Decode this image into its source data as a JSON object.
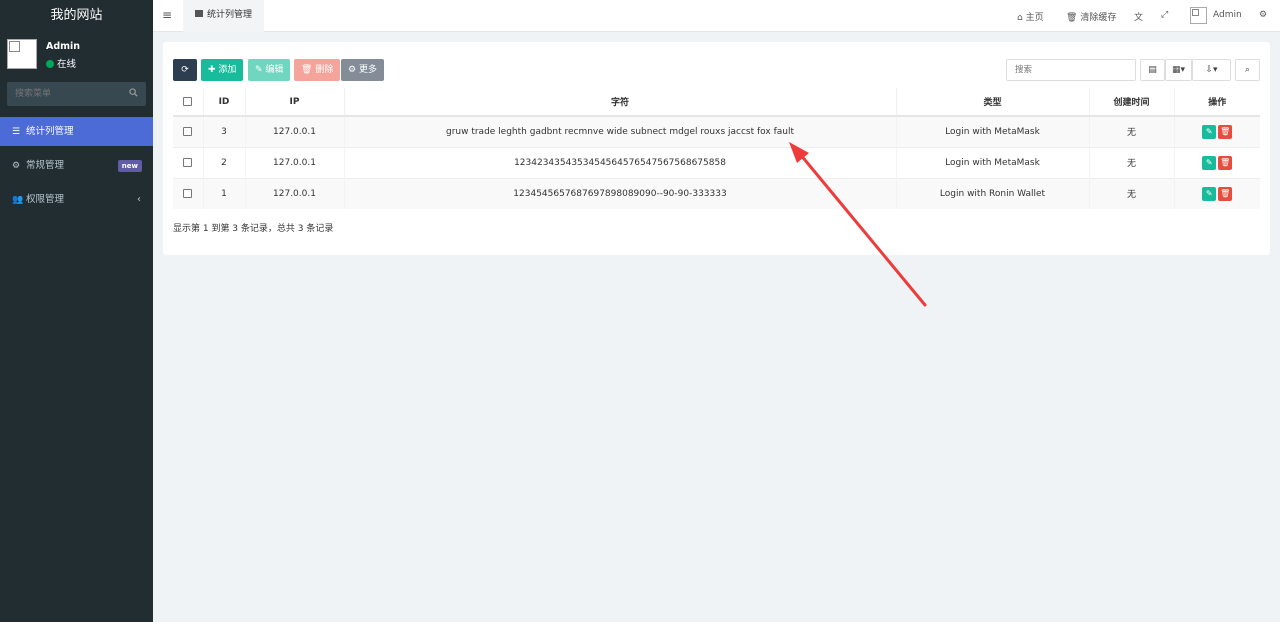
{
  "sidebar": {
    "logo": "我的网站",
    "user_name": "Admin",
    "user_status": "在线",
    "search_placeholder": "搜索菜单",
    "items": [
      {
        "label": "统计列管理",
        "icon": "list-icon",
        "active": true
      },
      {
        "label": "常规管理",
        "icon": "gears-icon",
        "badge": "new"
      },
      {
        "label": "权限管理",
        "icon": "users-icon"
      }
    ]
  },
  "topbar": {
    "tab_label": "统计列管理",
    "home": "主页",
    "clear_cache": "清除缓存",
    "user": "Admin"
  },
  "toolbar": {
    "add": "添加",
    "edit": "编辑",
    "delete": "删除",
    "more": "更多",
    "search_placeholder": "搜索"
  },
  "table": {
    "headers": [
      "ID",
      "IP",
      "字符",
      "类型",
      "创建时间",
      "操作"
    ],
    "rows": [
      {
        "id": "3",
        "ip": "127.0.0.1",
        "text": "gruw trade leghth gadbnt recmnve wide subnect mdgel rouxs jaccst fox fault",
        "type": "Login with MetaMask",
        "created": "无"
      },
      {
        "id": "2",
        "ip": "127.0.0.1",
        "text": "123423435435345456457654756756867585​8",
        "type": "Login with MetaMask",
        "created": "无"
      },
      {
        "id": "1",
        "ip": "127.0.0.1",
        "text": "123454565768769789808909​0--90-90-333333",
        "type": "Login with Ronin Wallet",
        "created": "无"
      }
    ],
    "summary": "显示第 1 到第 3 条记录，总共 3 条记录"
  },
  "colors": {
    "sidebar_bg": "#222d32",
    "active_menu": "#4c6bd6",
    "success": "#18bc9c",
    "danger": "#e74c3c",
    "annotation_arrow": "#ee3b3b"
  }
}
